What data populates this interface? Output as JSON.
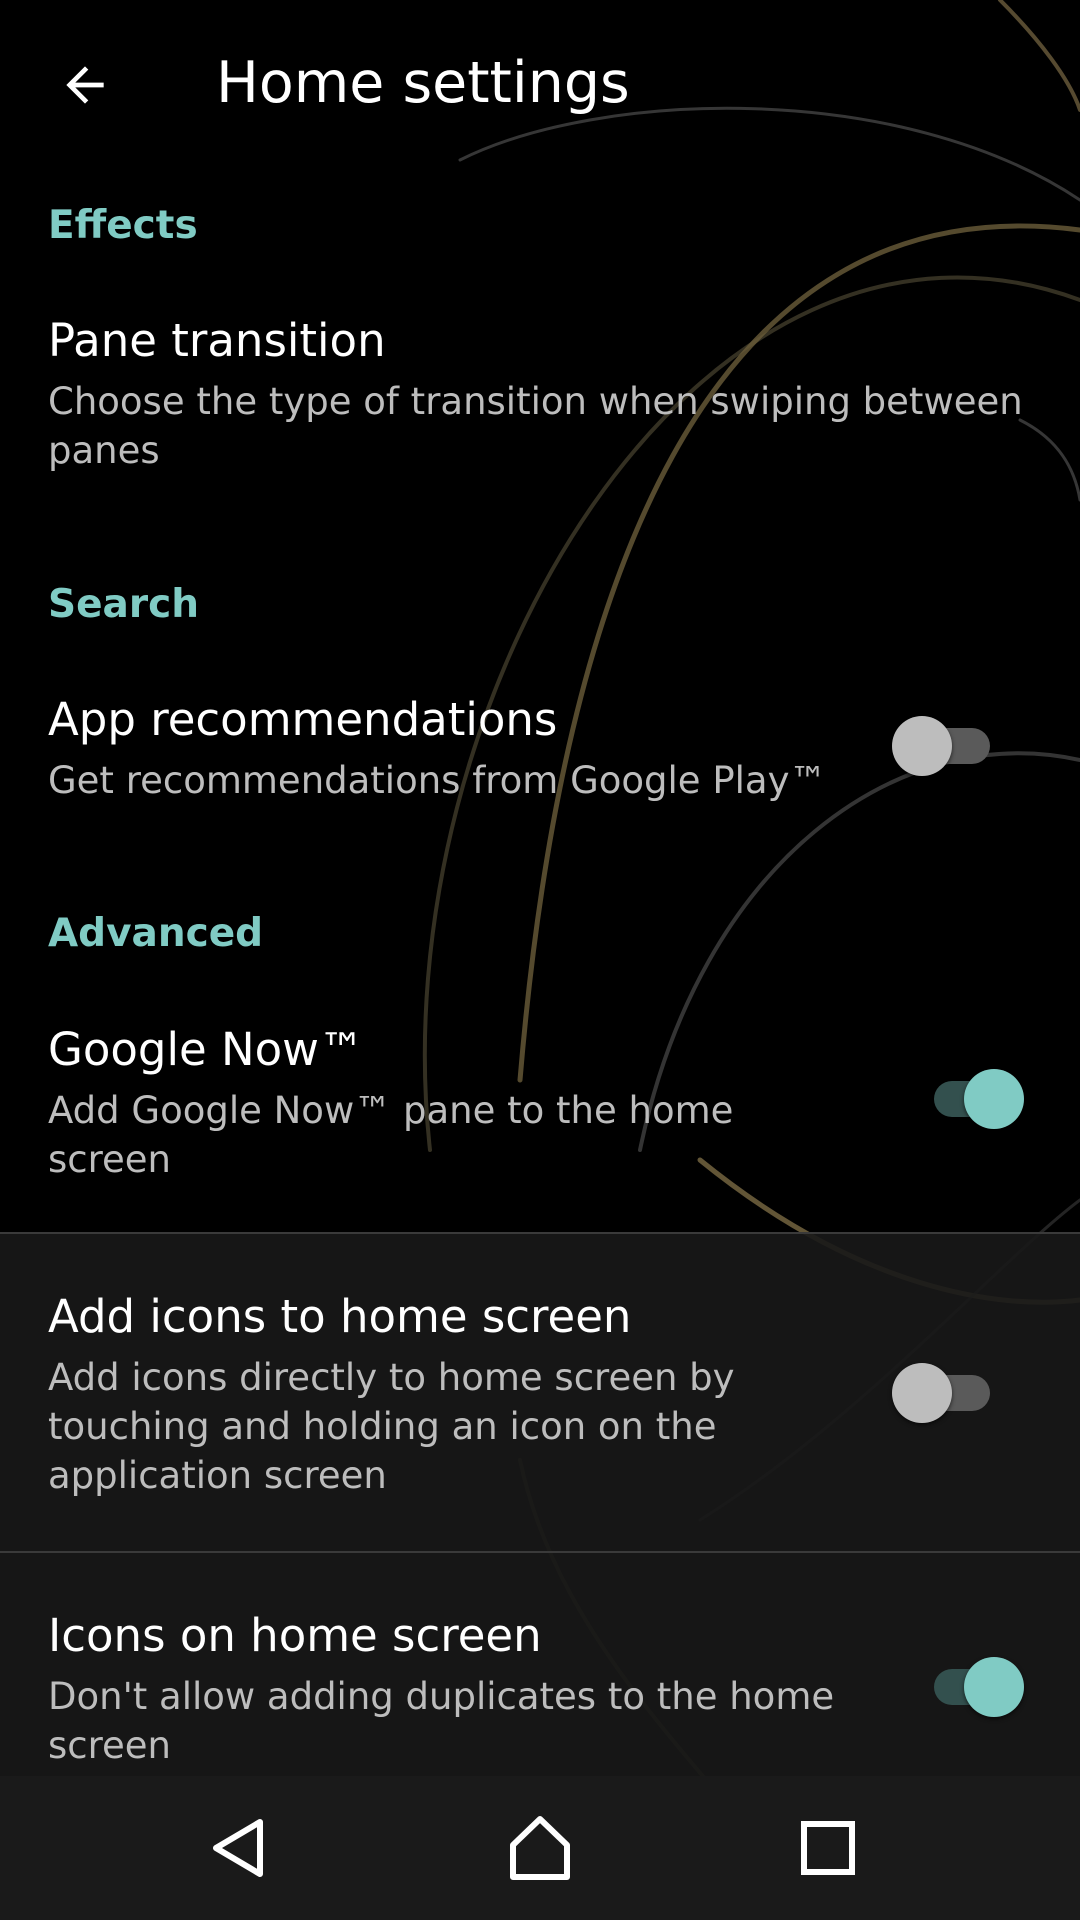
{
  "toolbar": {
    "back_icon": "arrow-left-icon",
    "title": "Home settings"
  },
  "colors": {
    "accent": "#80cbc4",
    "background": "#000000",
    "summary_text": "#bdbdbd",
    "switch_off_thumb": "#bdbdbd"
  },
  "sections": [
    {
      "header": "Effects",
      "items": [
        {
          "title": "Pane transition",
          "summary": "Choose the type of transition when swiping between panes"
        }
      ]
    },
    {
      "header": "Search",
      "items": [
        {
          "title": "App recommendations",
          "summary": "Get recommendations from Google Play™",
          "switch_on": false
        }
      ]
    },
    {
      "header": "Advanced",
      "items": [
        {
          "title": "Google Now™",
          "summary": "Add Google Now™ pane to the home screen",
          "switch_on": true
        },
        {
          "title": "Add icons to home screen",
          "summary": "Add icons directly to home screen by touching and holding an icon on the application screen",
          "switch_on": false
        },
        {
          "title": "Icons on home screen",
          "summary": "Don't allow adding duplicates to the home screen",
          "switch_on": true
        }
      ]
    }
  ],
  "navbar": {
    "back_icon": "triangle-back-icon",
    "home_icon": "home-icon",
    "recents_icon": "square-recents-icon"
  }
}
